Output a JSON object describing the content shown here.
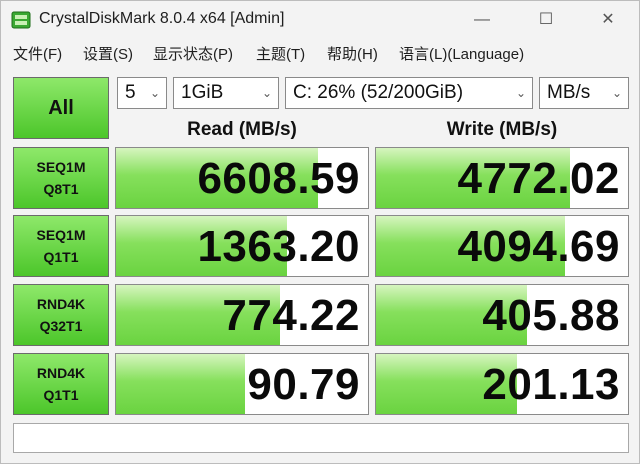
{
  "window": {
    "title": "CrystalDiskMark 8.0.4 x64 [Admin]",
    "controls": {
      "minimize": "—",
      "maximize": "☐",
      "close": "✕"
    }
  },
  "menu": [
    "文件(F)",
    "设置(S)",
    "显示状态(P)",
    "主题(T)",
    "帮助(H)",
    "语言(L)(Language)"
  ],
  "controls": {
    "all_label": "All",
    "count": "5",
    "size": "1GiB",
    "drive": "C: 26% (52/200GiB)",
    "unit": "MB/s"
  },
  "headers": {
    "read": "Read (MB/s)",
    "write": "Write (MB/s)"
  },
  "tests": [
    {
      "line1": "SEQ1M",
      "line2": "Q8T1",
      "read": "6608.59",
      "write": "4772.02",
      "read_fill": 0.8,
      "write_fill": 0.77
    },
    {
      "line1": "SEQ1M",
      "line2": "Q1T1",
      "read": "1363.20",
      "write": "4094.69",
      "read_fill": 0.68,
      "write_fill": 0.75
    },
    {
      "line1": "RND4K",
      "line2": "Q32T1",
      "read": "774.22",
      "write": "405.88",
      "read_fill": 0.65,
      "write_fill": 0.6
    },
    {
      "line1": "RND4K",
      "line2": "Q1T1",
      "read": "90.79",
      "write": "201.13",
      "read_fill": 0.51,
      "write_fill": 0.56
    }
  ],
  "status_text": "",
  "colors": {
    "bar_green": "#6ad340",
    "button_green": "#4cc62a"
  }
}
